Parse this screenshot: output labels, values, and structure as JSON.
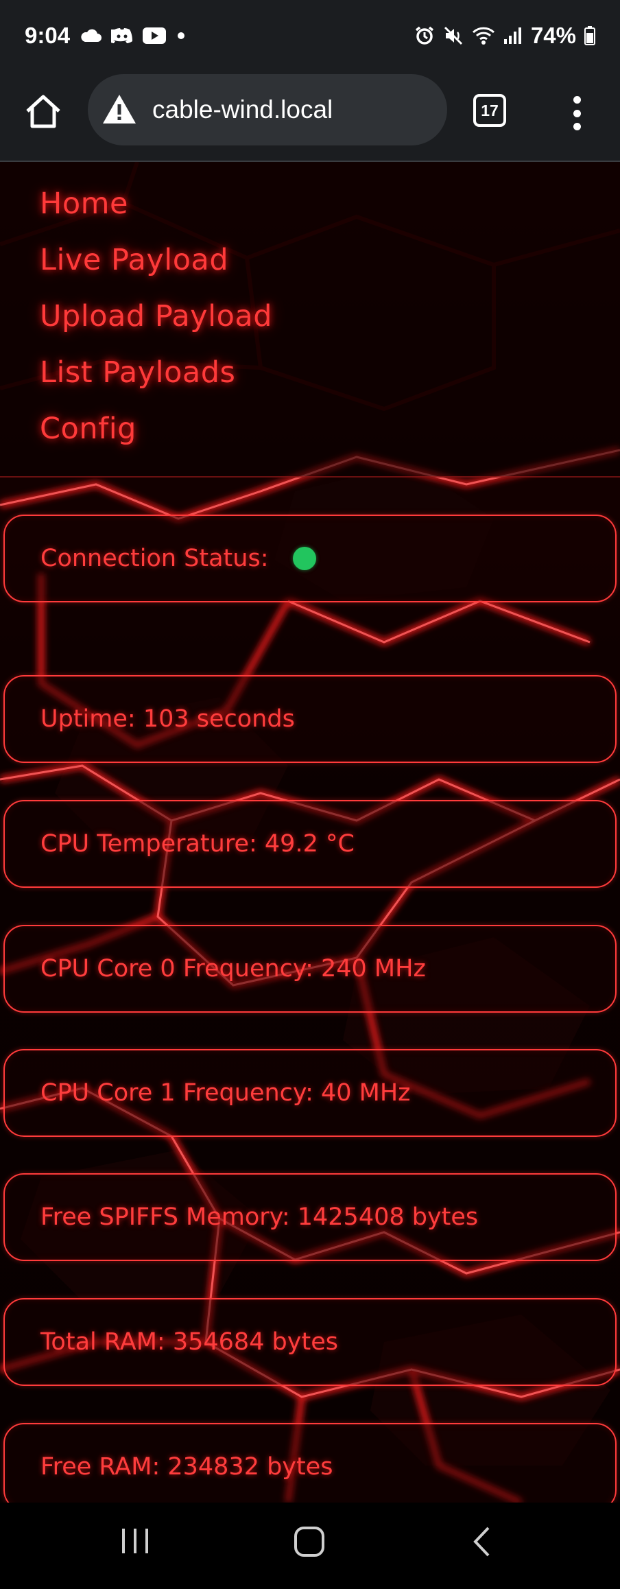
{
  "status_bar": {
    "time": "9:04",
    "battery": "74%",
    "left_icons": [
      "cloud-icon",
      "discord-icon",
      "youtube-icon",
      "dot-icon"
    ],
    "right_icons": [
      "alarm-icon",
      "mute-icon",
      "wifi-icon",
      "signal-icon",
      "battery-icon"
    ]
  },
  "browser": {
    "url": "cable-wind.local",
    "tab_count": "17",
    "security_icon": "warning-icon"
  },
  "nav": {
    "items": [
      {
        "label": "Home"
      },
      {
        "label": "Live Payload"
      },
      {
        "label": "Upload Payload"
      },
      {
        "label": "List Payloads"
      },
      {
        "label": "Config"
      }
    ]
  },
  "cards": {
    "connection": {
      "label": "Connection Status:",
      "status_color": "#22c55e"
    },
    "uptime": "Uptime: 103 seconds",
    "cpu_temp": "CPU Temperature: 49.2 °C",
    "core0": "CPU Core 0 Frequency: 240 MHz",
    "core1": "CPU Core 1 Frequency: 40 MHz",
    "spiffs": "Free SPIFFS Memory: 1425408 bytes",
    "total_ram": "Total RAM: 354684 bytes",
    "free_ram": "Free RAM: 234832 bytes"
  },
  "colors": {
    "accent": "#ff3b3b",
    "browser_bg": "#1b1d20",
    "url_bg": "#2f3236"
  }
}
